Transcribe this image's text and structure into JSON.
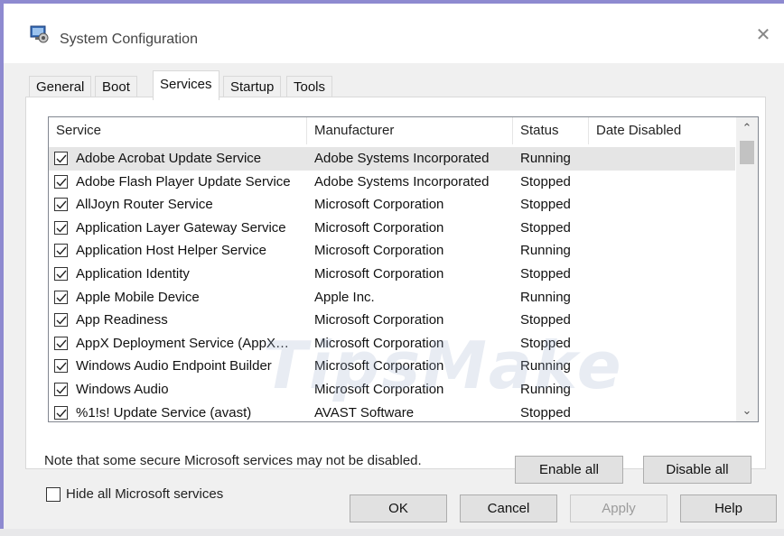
{
  "window": {
    "title": "System Configuration",
    "close_glyph": "✕",
    "icon": "system-config-icon"
  },
  "tabs": [
    {
      "label": "General",
      "active": false
    },
    {
      "label": "Boot",
      "active": false
    },
    {
      "label": "Services",
      "active": true
    },
    {
      "label": "Startup",
      "active": false
    },
    {
      "label": "Tools",
      "active": false
    }
  ],
  "services": {
    "columns": [
      "Service",
      "Manufacturer",
      "Status",
      "Date Disabled"
    ],
    "rows": [
      {
        "name": "Adobe Acrobat Update Service",
        "manufacturer": "Adobe Systems Incorporated",
        "status": "Running",
        "date_disabled": "",
        "checked": true,
        "selected": true
      },
      {
        "name": "Adobe Flash Player Update Service",
        "manufacturer": "Adobe Systems Incorporated",
        "status": "Stopped",
        "date_disabled": "",
        "checked": true,
        "selected": false
      },
      {
        "name": "AllJoyn Router Service",
        "manufacturer": "Microsoft Corporation",
        "status": "Stopped",
        "date_disabled": "",
        "checked": true,
        "selected": false
      },
      {
        "name": "Application Layer Gateway Service",
        "manufacturer": "Microsoft Corporation",
        "status": "Stopped",
        "date_disabled": "",
        "checked": true,
        "selected": false
      },
      {
        "name": "Application Host Helper Service",
        "manufacturer": "Microsoft Corporation",
        "status": "Running",
        "date_disabled": "",
        "checked": true,
        "selected": false
      },
      {
        "name": "Application Identity",
        "manufacturer": "Microsoft Corporation",
        "status": "Stopped",
        "date_disabled": "",
        "checked": true,
        "selected": false
      },
      {
        "name": "Apple Mobile Device",
        "manufacturer": "Apple Inc.",
        "status": "Running",
        "date_disabled": "",
        "checked": true,
        "selected": false
      },
      {
        "name": "App Readiness",
        "manufacturer": "Microsoft Corporation",
        "status": "Stopped",
        "date_disabled": "",
        "checked": true,
        "selected": false
      },
      {
        "name": "AppX Deployment Service (AppX…",
        "manufacturer": "Microsoft Corporation",
        "status": "Stopped",
        "date_disabled": "",
        "checked": true,
        "selected": false
      },
      {
        "name": "Windows Audio Endpoint Builder",
        "manufacturer": "Microsoft Corporation",
        "status": "Running",
        "date_disabled": "",
        "checked": true,
        "selected": false
      },
      {
        "name": "Windows Audio",
        "manufacturer": "Microsoft Corporation",
        "status": "Running",
        "date_disabled": "",
        "checked": true,
        "selected": false
      },
      {
        "name": "%1!s! Update Service (avast)",
        "manufacturer": "AVAST Software",
        "status": "Stopped",
        "date_disabled": "",
        "checked": true,
        "selected": false
      }
    ]
  },
  "scrollbar": {
    "up_glyph": "⌃",
    "down_glyph": "⌄",
    "position": 0.0
  },
  "note": "Note that some secure Microsoft services may not be disabled.",
  "buttons": {
    "enable_all": "Enable all",
    "disable_all": "Disable all",
    "ok": "OK",
    "cancel": "Cancel",
    "apply": "Apply",
    "help": "Help"
  },
  "hide_ms": {
    "label": "Hide all Microsoft services",
    "checked": false
  },
  "watermark": "TipsMake",
  "colors": {
    "frame": "#8e8ad0",
    "selected_row": "#e5e5e5",
    "dialog_bg": "#f0f0f0"
  }
}
